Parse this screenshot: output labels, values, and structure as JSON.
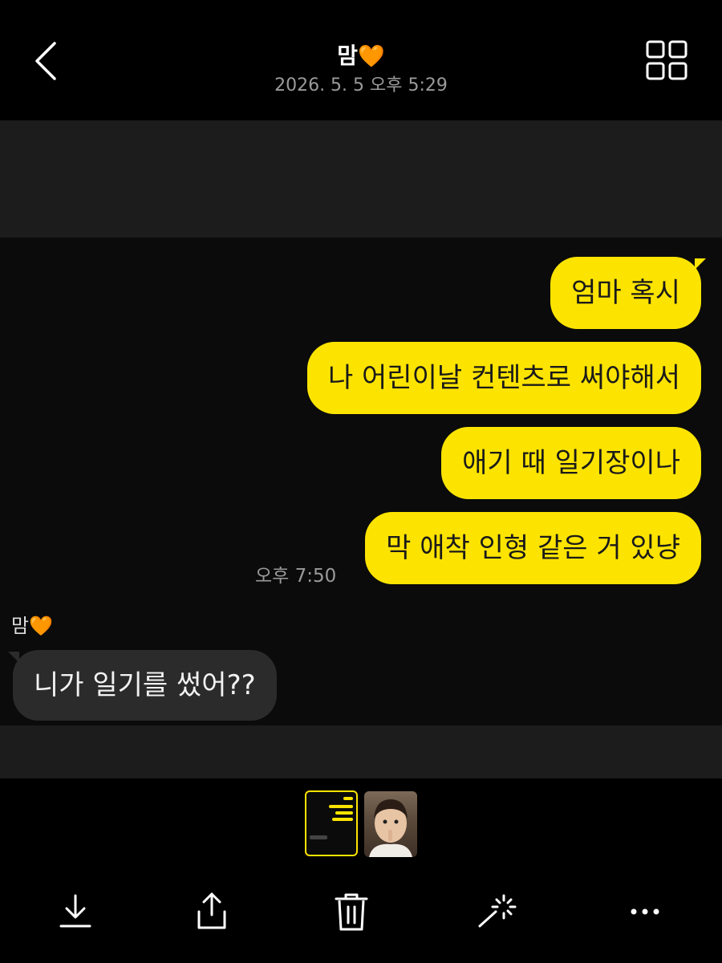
{
  "header": {
    "title": "맘",
    "title_emoji": "🧡",
    "subtitle": "2026. 5. 5 오후 5:29"
  },
  "chat": {
    "outgoing": [
      "엄마 혹시",
      "나 어린이날 컨텐츠로 써야해서",
      "애기 때 일기장이나",
      "막 애착 인형 같은 거 있냥"
    ],
    "outgoing_time": "오후 7:50",
    "sender_name": "맘",
    "sender_emoji": "🧡",
    "incoming": [
      "니가 일기를 썼어??"
    ]
  },
  "colors": {
    "outgoing_bubble": "#fde400",
    "incoming_bubble": "#2b2b2b",
    "background": "#000000",
    "backdrop": "#1c1c1c"
  },
  "icons": {
    "back": "chevron-left-icon",
    "grid": "grid-icon",
    "download": "download-icon",
    "share": "share-icon",
    "delete": "trash-icon",
    "effects": "magic-wand-icon",
    "more": "more-icon"
  }
}
